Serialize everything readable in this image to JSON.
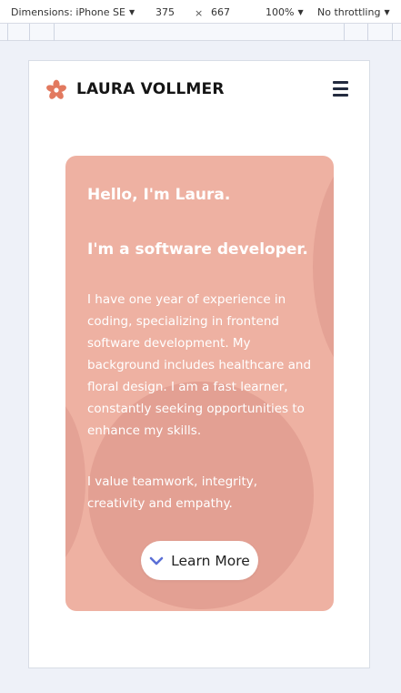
{
  "devtools": {
    "device_label": "Dimensions: iPhone SE",
    "width_value": "375",
    "times_symbol": "×",
    "height_value": "667",
    "zoom_label": "100%",
    "throttle_label": "No throttling"
  },
  "site": {
    "title": "LAURA VOLLMER",
    "logo_icon": "flower-icon",
    "menu_icon": "hamburger-menu-icon"
  },
  "hero": {
    "greeting": "Hello, I'm Laura.",
    "role": "I'm a software developer.",
    "bio": "I have one year of experience in coding, specializing in frontend software development. My background includes healthcare and floral design. I am a fast learner, constantly seeking opportunities to enhance my skills.",
    "values": "I value teamwork, integrity, creativity and empathy.",
    "cta_label": "Learn More",
    "cta_icon": "chevron-down-icon"
  },
  "colors": {
    "card_background": "#eeb1a2",
    "logo_accent": "#e2795f",
    "chevron_accent": "#5b6fd6",
    "menu_icon": "#232b3f"
  }
}
